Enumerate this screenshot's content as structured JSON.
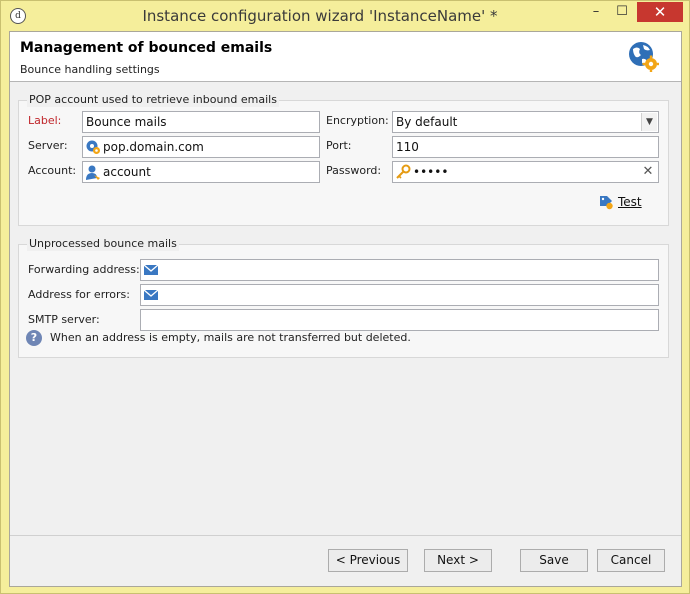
{
  "window": {
    "title": "Instance configuration wizard 'InstanceName' *",
    "app_icon_glyph": "d",
    "minimize_glyph": "–",
    "maximize_glyph": "☐",
    "close_glyph": "✕"
  },
  "header": {
    "title": "Management of bounced emails",
    "subtitle": "Bounce handling settings",
    "icon": "globe-settings-icon"
  },
  "pop_group": {
    "title": "POP account used to retrieve inbound emails",
    "label_label": "Label:",
    "label_value": "Bounce mails",
    "server_label": "Server:",
    "server_value": "pop.domain.com",
    "account_label": "Account:",
    "account_value": "account",
    "encryption_label": "Encryption:",
    "encryption_value": "By default",
    "port_label": "Port:",
    "port_value": "110",
    "password_label": "Password:",
    "password_value": "•••••",
    "test_label": "Test"
  },
  "bounce_group": {
    "title": "Unprocessed bounce mails",
    "forwarding_label": "Forwarding address:",
    "forwarding_value": "",
    "errors_label": "Address for errors:",
    "errors_value": "",
    "smtp_label": "SMTP server:",
    "smtp_value": "",
    "info_text": "When an address is empty, mails are not transferred but deleted."
  },
  "footer": {
    "previous_label": "< Previous",
    "next_label": "Next >",
    "save_label": "Save",
    "cancel_label": "Cancel"
  },
  "colors": {
    "title_bar": "#f5ee9b",
    "required_label": "#c0262b",
    "close_button": "#c7372f"
  }
}
